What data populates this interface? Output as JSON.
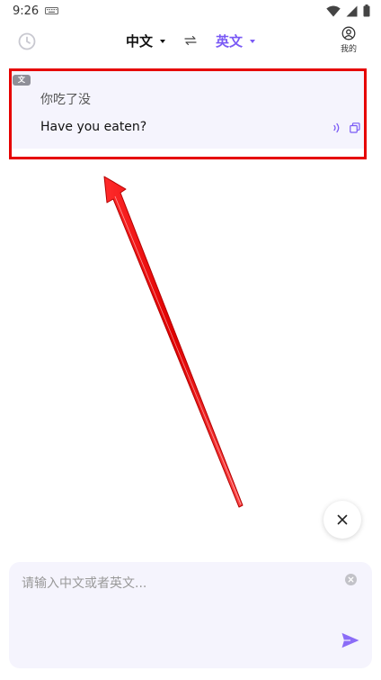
{
  "status_bar": {
    "time": "9:26",
    "icons": [
      "keyboard-icon",
      "wifi-icon",
      "signal-icon",
      "battery-icon"
    ]
  },
  "header": {
    "history_icon": "history-icon",
    "source_lang": "中文",
    "swap_icon": "swap-icon",
    "target_lang": "英文",
    "profile_label": "我的"
  },
  "result": {
    "tag": "文",
    "source_text": "你吃了没",
    "translated_text": "Have you eaten?",
    "icons": [
      "speaker-icon",
      "copy-icon"
    ]
  },
  "input": {
    "placeholder": "请输入中文或者英文...",
    "value": "",
    "icons": [
      "clear-icon",
      "send-icon"
    ]
  },
  "colors": {
    "accent": "#7a5af5",
    "card_bg": "#f5f4fd",
    "annotation_red": "#e60000"
  }
}
